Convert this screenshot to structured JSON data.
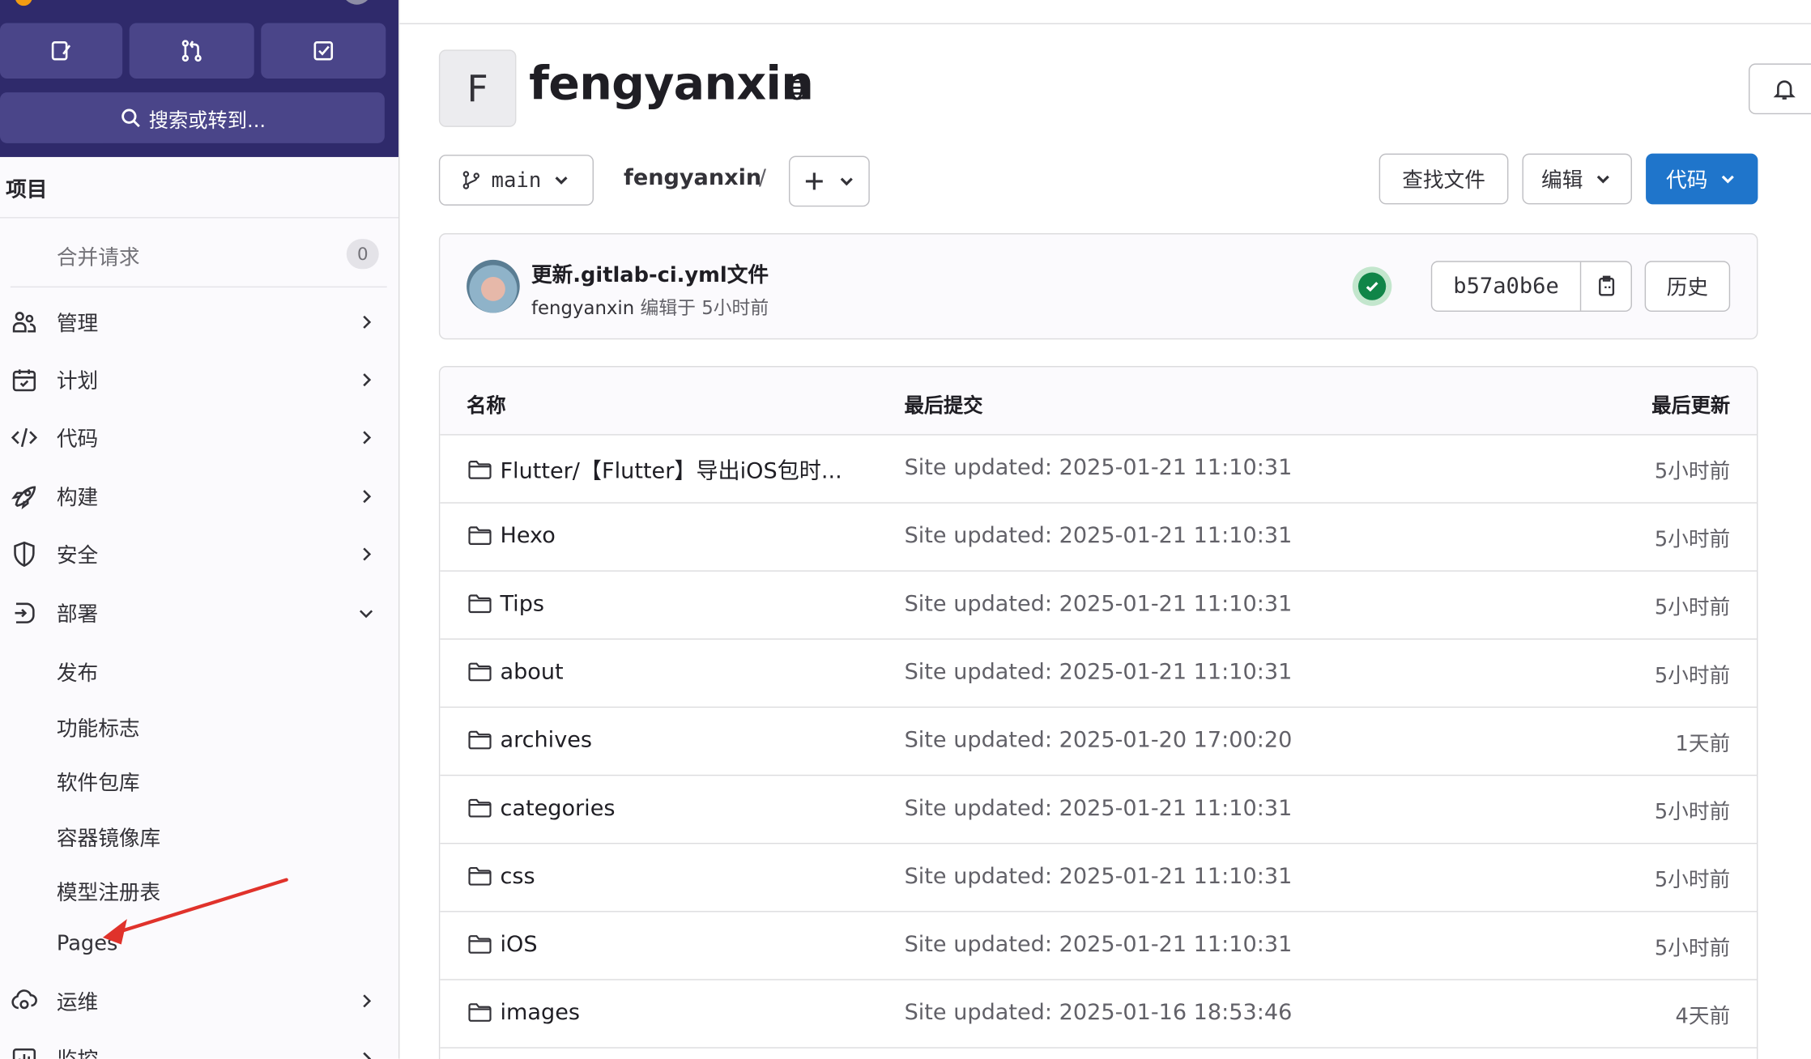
{
  "sidebar": {
    "search_label": "搜索或转到...",
    "section_title": "项目",
    "merge_requests": {
      "label": "合并请求",
      "count": "0"
    },
    "nav": [
      {
        "label": "管理",
        "icon": "users-icon"
      },
      {
        "label": "计划",
        "icon": "calendar-icon"
      },
      {
        "label": "代码",
        "icon": "code-icon"
      },
      {
        "label": "构建",
        "icon": "rocket-icon"
      },
      {
        "label": "安全",
        "icon": "shield-icon"
      },
      {
        "label": "部署",
        "icon": "deploy-icon"
      }
    ],
    "deploy_sub": [
      "发布",
      "功能标志",
      "软件包库",
      "容器镜像库",
      "模型注册表",
      "Pages"
    ],
    "ops": {
      "label": "运维",
      "icon": "cloud-gear-icon"
    },
    "monitor": {
      "label": "监控",
      "icon": "chart-icon"
    }
  },
  "project": {
    "avatar_letter": "F",
    "name": "fengyanxin",
    "visibility_icon": "globe-icon"
  },
  "toolbar": {
    "branch": "main",
    "breadcrumb": "fengyanxin",
    "separator": "/",
    "find_file": "查找文件",
    "edit": "编辑",
    "code": "代码"
  },
  "last_commit": {
    "title": "更新.gitlab-ci.yml文件",
    "author": "fengyanxin",
    "meta": "编辑于 5小时前",
    "sha": "b57a0b6e",
    "history": "历史",
    "pipeline_status": "passed"
  },
  "file_table": {
    "headers": {
      "name": "名称",
      "last_commit": "最后提交",
      "last_update": "最后更新"
    },
    "rows": [
      {
        "name": "Flutter/【Flutter】导出iOS包时...",
        "commit": "Site updated: 2025-01-21 11:10:31",
        "time": "5小时前"
      },
      {
        "name": "Hexo",
        "commit": "Site updated: 2025-01-21 11:10:31",
        "time": "5小时前"
      },
      {
        "name": "Tips",
        "commit": "Site updated: 2025-01-21 11:10:31",
        "time": "5小时前"
      },
      {
        "name": "about",
        "commit": "Site updated: 2025-01-21 11:10:31",
        "time": "5小时前"
      },
      {
        "name": "archives",
        "commit": "Site updated: 2025-01-20 17:00:20",
        "time": "1天前"
      },
      {
        "name": "categories",
        "commit": "Site updated: 2025-01-21 11:10:31",
        "time": "5小时前"
      },
      {
        "name": "css",
        "commit": "Site updated: 2025-01-21 11:10:31",
        "time": "5小时前"
      },
      {
        "name": "iOS",
        "commit": "Site updated: 2025-01-21 11:10:31",
        "time": "5小时前"
      },
      {
        "name": "images",
        "commit": "Site updated: 2025-01-16 18:53:46",
        "time": "4天前"
      }
    ]
  },
  "colors": {
    "sidebar_header": "#2f2a6b",
    "sidebar_button": "#4a4589",
    "primary": "#1f75cb",
    "success": "#108548",
    "annotation_arrow": "#e0322b"
  }
}
